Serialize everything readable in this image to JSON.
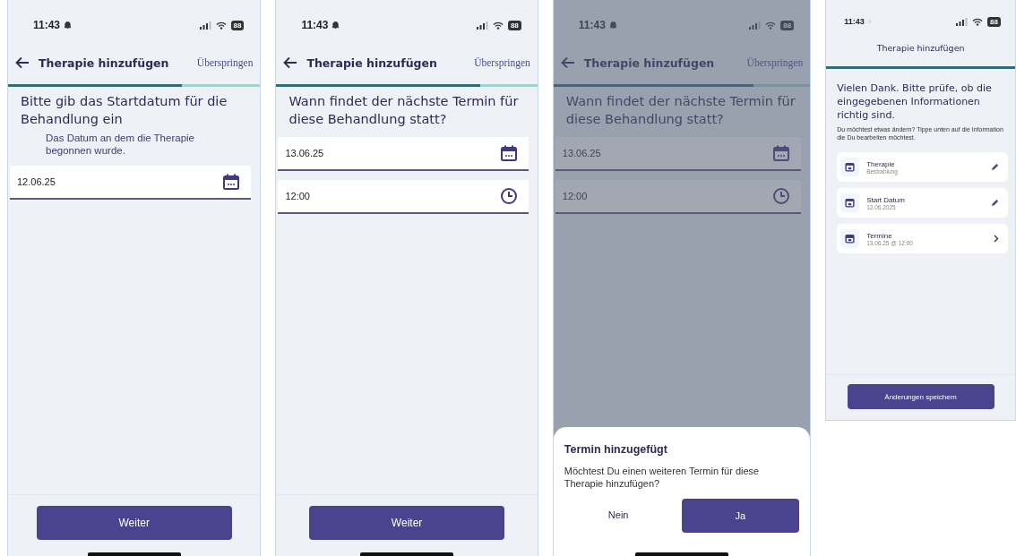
{
  "screens": [
    {
      "kind": "form",
      "status": {
        "time": "11:43",
        "silent": true,
        "battery": "88"
      },
      "nav": {
        "back": true,
        "title": "Therapie hinzufügen",
        "skip": "Überspringen"
      },
      "progress": {
        "level": 0.69
      },
      "heading": "Bitte gib das Startdatum für die Behandlung ein",
      "hint": "Das Datum an dem die Therapie begonnen wurde.",
      "fields": [
        {
          "kind": "date",
          "value": "12.06.25"
        }
      ],
      "button": "Weiter"
    },
    {
      "kind": "form",
      "status": {
        "time": "11:43",
        "silent": true,
        "battery": "88"
      },
      "nav": {
        "back": true,
        "title": "Therapie hinzufügen",
        "skip": "Überspringen"
      },
      "progress": {
        "level": 0.78
      },
      "heading": "Wann findet der nächste Termin für diese Behandlung statt?",
      "fields": [
        {
          "kind": "date",
          "value": "13.06.25"
        },
        {
          "kind": "time",
          "value": "12:00"
        }
      ],
      "button": "Weiter"
    },
    {
      "kind": "form",
      "status": {
        "time": "11:43",
        "silent": true,
        "battery": "88"
      },
      "nav": {
        "back": true,
        "title": "Therapie hinzufügen",
        "skip": "Überspringen"
      },
      "progress": {
        "level": 0.78
      },
      "heading": "Wann findet der nächste Termin für diese Behandlung statt?",
      "fields": [
        {
          "kind": "date",
          "value": "13.06.25"
        },
        {
          "kind": "time",
          "value": "12:00"
        }
      ],
      "dialog": {
        "title": "Termin hinzugefügt",
        "message": "Möchtest Du einen weiteren Termin für diese Therapie hinzufügen?",
        "cancel": "Nein",
        "confirm": "Ja"
      }
    },
    {
      "kind": "summary",
      "status": {
        "time": "11:43",
        "silent": false,
        "battery": "88"
      },
      "nav": {
        "back": false,
        "title": "Therapie hinzufügen"
      },
      "progress": {
        "level": 1
      },
      "heading": "Vielen Dank. Bitte prüfe, ob die eingegebenen Informationen richtig sind.",
      "hint": "Du möchtest etwas ändern? Tippe unten auf die Information die Du bearbeiten möchtest.",
      "items": [
        {
          "label": "Therapie",
          "value": "Bestrahlung",
          "kind": "edit"
        },
        {
          "label": "Start Datum",
          "value": "12.06.2025",
          "kind": "edit"
        },
        {
          "label": "Termine",
          "value": "13.06.25 @ 12:00",
          "kind": "open"
        }
      ],
      "button": "Änderungen speichern"
    }
  ]
}
